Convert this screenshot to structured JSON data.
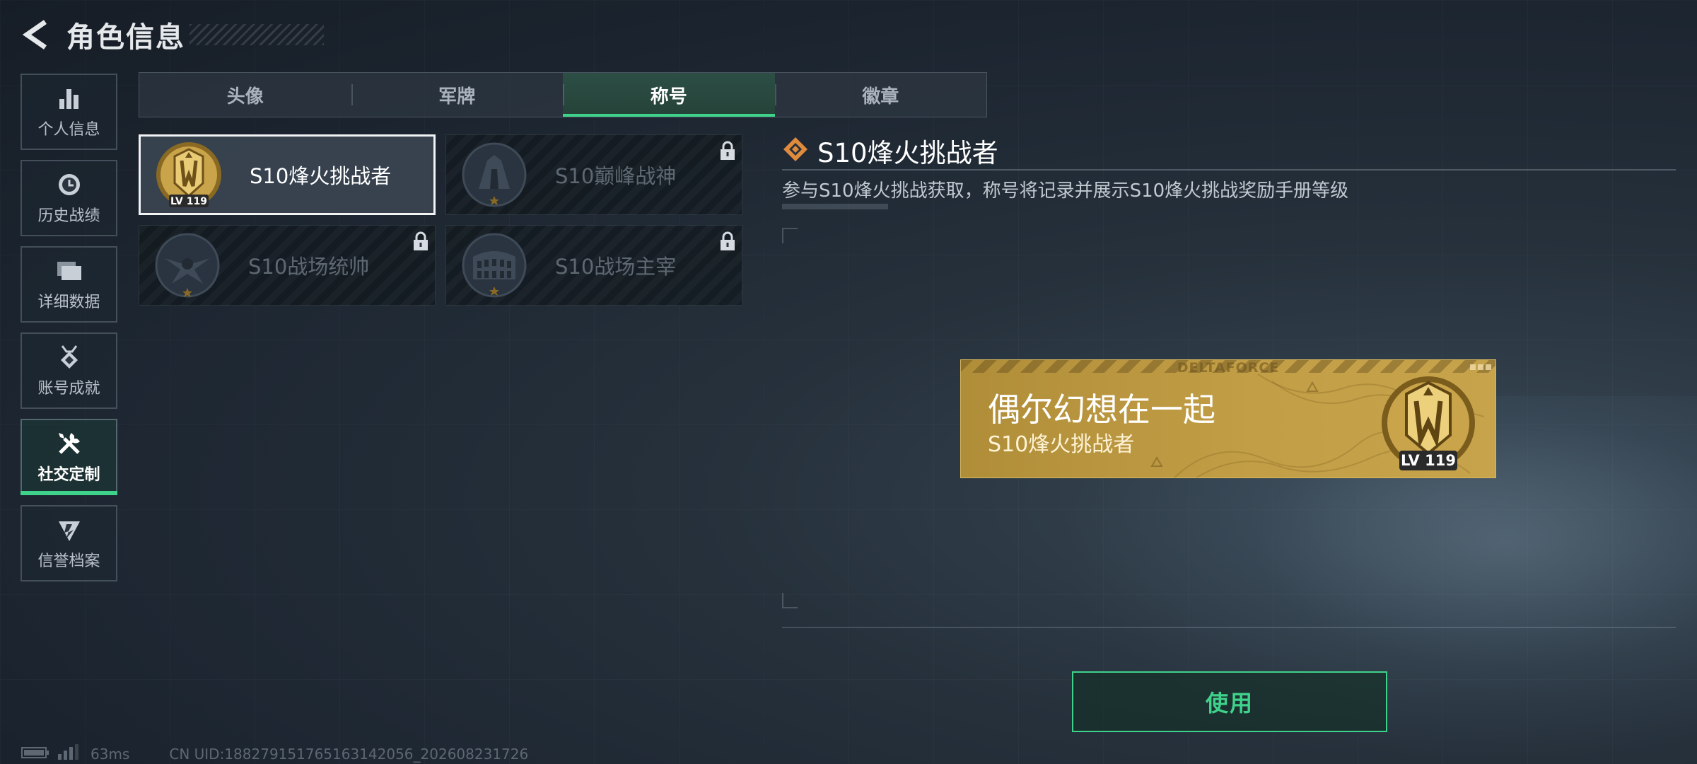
{
  "header": {
    "title": "角色信息"
  },
  "sidebar": {
    "items": [
      {
        "label": "个人信息",
        "icon": "bar-chart-icon"
      },
      {
        "label": "历史战绩",
        "icon": "clock-icon"
      },
      {
        "label": "详细数据",
        "icon": "folders-icon"
      },
      {
        "label": "账号成就",
        "icon": "medal-icon"
      },
      {
        "label": "社交定制",
        "icon": "tools-icon",
        "active": true
      },
      {
        "label": "信誉档案",
        "icon": "shield-icon"
      }
    ]
  },
  "tabs": [
    {
      "label": "头像"
    },
    {
      "label": "军牌"
    },
    {
      "label": "称号",
      "active": true
    },
    {
      "label": "徽章"
    }
  ],
  "titles": [
    {
      "name": "S10烽火挑战者",
      "selected": true,
      "locked": false,
      "level": "LV 119"
    },
    {
      "name": "S10巅峰战神",
      "selected": false,
      "locked": true
    },
    {
      "name": "S10战场统帅",
      "selected": false,
      "locked": true
    },
    {
      "name": "S10战场主宰",
      "selected": false,
      "locked": true
    }
  ],
  "detail": {
    "title": "S10烽火挑战者",
    "description": "参与S10烽火挑战获取，称号将记录并展示S10烽火挑战奖励手册等级"
  },
  "banner": {
    "brand": "DELTAFORCE",
    "nickname": "偶尔幻想在一起",
    "title": "S10烽火挑战者",
    "level": "LV 119"
  },
  "use_button": {
    "label": "使用"
  },
  "footer": {
    "ping": "63ms",
    "uid": "CN UID:18827915176516314​2056_202608231726"
  },
  "colors": {
    "accent": "#3fd28b",
    "gold": "#c29e46",
    "orange_icon": "#e08a3c"
  }
}
